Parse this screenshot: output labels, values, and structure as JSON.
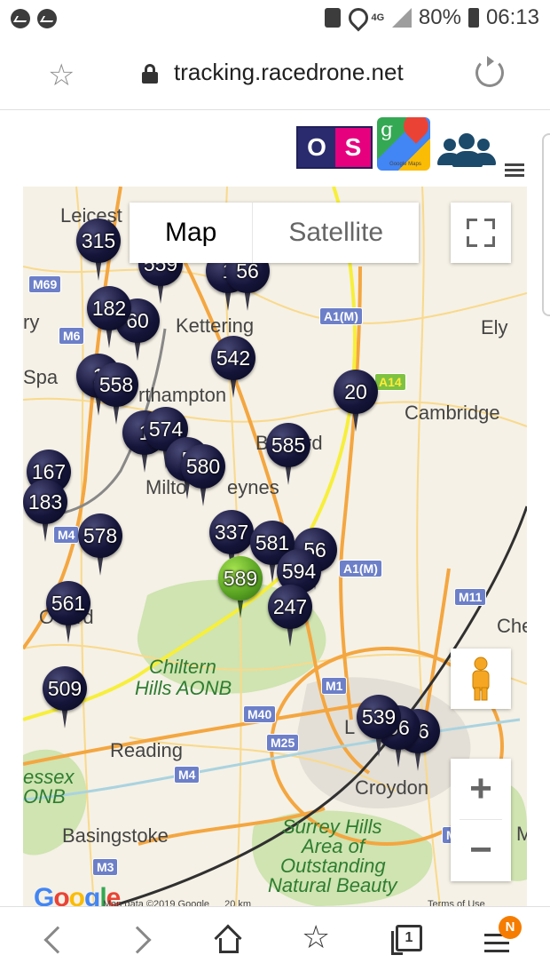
{
  "status_bar": {
    "network": "4G",
    "battery": "80%",
    "time": "06:13"
  },
  "browser": {
    "url": "tracking.racedrone.net"
  },
  "header": {
    "os_logo_left": "O",
    "os_logo_right": "S",
    "gmaps_letter": "g",
    "gmaps_caption": "Google Maps"
  },
  "map": {
    "type_buttons": [
      "Map",
      "Satellite"
    ],
    "place_labels": [
      {
        "text": "Leicest",
        "style": "place"
      },
      {
        "text": "Kettering",
        "style": "place"
      },
      {
        "text": "rthampton",
        "style": "place"
      },
      {
        "text": "Cambridge",
        "style": "place"
      },
      {
        "text": "Ely",
        "style": "place"
      },
      {
        "text": "Milto",
        "style": "place"
      },
      {
        "text": "eynes",
        "style": "place"
      },
      {
        "text": "B",
        "style": "place"
      },
      {
        "text": "rd",
        "style": "place"
      },
      {
        "text": "rd",
        "style": "place"
      },
      {
        "text": "Chiltern",
        "style": "green"
      },
      {
        "text": "Hills AONB",
        "style": "green"
      },
      {
        "text": "Reading",
        "style": "place"
      },
      {
        "text": "Croydon",
        "style": "place"
      },
      {
        "text": "Basingstoke",
        "style": "place"
      },
      {
        "text": "Surrey Hills",
        "style": "green"
      },
      {
        "text": "Area of",
        "style": "green"
      },
      {
        "text": "Outstanding",
        "style": "green"
      },
      {
        "text": "Natural Beauty",
        "style": "green"
      },
      {
        "text": "essex",
        "style": "green"
      },
      {
        "text": "ONB",
        "style": "green"
      },
      {
        "text": "Che",
        "style": "place"
      },
      {
        "text": "ry",
        "style": "place"
      },
      {
        "text": "Spa",
        "style": "place"
      },
      {
        "text": "L",
        "style": "place"
      },
      {
        "text": "M",
        "style": "place"
      },
      {
        "text": "O",
        "style": "place"
      }
    ],
    "road_shields": [
      "M69",
      "M6",
      "A1(M)",
      "A14",
      "M4",
      "A1(M)",
      "M11",
      "M1",
      "M40",
      "M25",
      "M4",
      "M3",
      "M"
    ],
    "markers": [
      {
        "label": "315",
        "color": "dark"
      },
      {
        "label": "559",
        "color": "dark"
      },
      {
        "label": "1",
        "color": "dark"
      },
      {
        "label": "56",
        "color": "dark"
      },
      {
        "label": "182",
        "color": "dark"
      },
      {
        "label": "60",
        "color": "dark"
      },
      {
        "label": "542",
        "color": "dark"
      },
      {
        "label": "1",
        "color": "dark"
      },
      {
        "label": "558",
        "color": "dark"
      },
      {
        "label": "20",
        "color": "dark"
      },
      {
        "label": "1",
        "color": "dark"
      },
      {
        "label": "574",
        "color": "dark"
      },
      {
        "label": "5",
        "color": "dark"
      },
      {
        "label": "580",
        "color": "dark"
      },
      {
        "label": "585",
        "color": "dark"
      },
      {
        "label": "167",
        "color": "dark"
      },
      {
        "label": "183",
        "color": "dark"
      },
      {
        "label": "578",
        "color": "dark"
      },
      {
        "label": "337",
        "color": "dark"
      },
      {
        "label": "581",
        "color": "dark"
      },
      {
        "label": "56",
        "color": "dark"
      },
      {
        "label": "594",
        "color": "dark"
      },
      {
        "label": "589",
        "color": "green"
      },
      {
        "label": "247",
        "color": "dark"
      },
      {
        "label": "561",
        "color": "dark"
      },
      {
        "label": "509",
        "color": "dark"
      },
      {
        "label": "539",
        "color": "dark"
      },
      {
        "label": "56",
        "color": "dark"
      },
      {
        "label": "26",
        "color": "dark"
      }
    ],
    "zoom_in": "+",
    "zoom_out": "−",
    "google_logo": "Google",
    "footer_data": "Map data ©2019 Google",
    "footer_scale": "20 km",
    "footer_terms": "Terms of Use"
  },
  "bottom_nav": {
    "tabs_count": "1",
    "badge": "N"
  },
  "colors": {
    "marker_dark": "#15153a",
    "marker_active": "#5ca624",
    "motorway_shield": "#6c7fc8",
    "a_road": "#f7e55b",
    "aonb": "#c8dfa8",
    "badge": "#f57c00"
  }
}
